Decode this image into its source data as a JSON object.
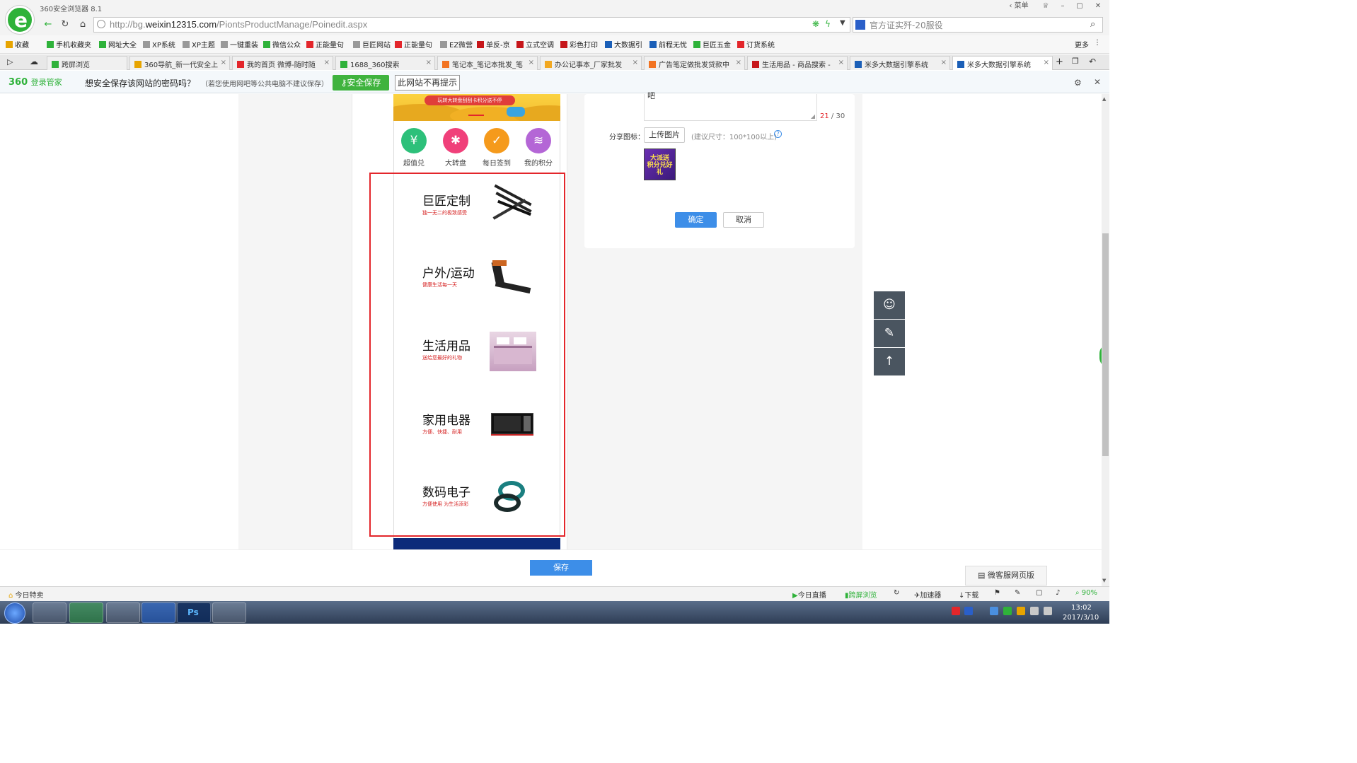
{
  "window": {
    "title": "360安全浏览器 8.1",
    "controls": [
      "菜单"
    ]
  },
  "address": {
    "url_prefix": "http://bg.",
    "url_domain": "weixin12315.com",
    "url_path": "/PiontsProductManage/Poinedit.aspx",
    "search_text": "官方证实歼-20服役"
  },
  "bookmarks": {
    "items": [
      {
        "label": "收藏",
        "color": "#e7a400"
      },
      {
        "label": "手机收藏夹",
        "color": "#2fb23a"
      },
      {
        "label": "网址大全",
        "color": "#2fb23a"
      },
      {
        "label": "XP系统",
        "color": "#999999"
      },
      {
        "label": "XP主题",
        "color": "#999999"
      },
      {
        "label": "一键重装",
        "color": "#999999"
      },
      {
        "label": "微信公众",
        "color": "#2fb23a"
      },
      {
        "label": "正能量句",
        "color": "#e3262b"
      },
      {
        "label": "巨匠网站",
        "color": "#999999"
      },
      {
        "label": "正能量句",
        "color": "#e3262b"
      },
      {
        "label": "EZ微营",
        "color": "#999999"
      },
      {
        "label": "单反-京",
        "color": "#c6161a"
      },
      {
        "label": "立式空调",
        "color": "#c6161a"
      },
      {
        "label": "彩色打印",
        "color": "#c6161a"
      },
      {
        "label": "大数据引",
        "color": "#1b5fb7"
      },
      {
        "label": "前程无忧",
        "color": "#1b5fb7"
      },
      {
        "label": "巨匠五金",
        "color": "#2fb23a"
      },
      {
        "label": "订货系统",
        "color": "#e3262b"
      }
    ],
    "more": "更多"
  },
  "tabs": [
    {
      "label": "跨屏浏览",
      "color": "#2fb23a",
      "active": false
    },
    {
      "label": "360导航_新一代安全上",
      "color": "#e7a400",
      "active": false
    },
    {
      "label": "我的首页 微博-随时随",
      "color": "#e3262b",
      "active": false
    },
    {
      "label": "1688_360搜索",
      "color": "#2fb23a",
      "active": false
    },
    {
      "label": "笔记本_笔记本批发_笔",
      "color": "#f27321",
      "active": false
    },
    {
      "label": "办公记事本_厂家批发",
      "color": "#f2a821",
      "active": false
    },
    {
      "label": "广告笔定做批发贷款中",
      "color": "#f27321",
      "active": false
    },
    {
      "label": "生活用品 - 商品搜索 -",
      "color": "#c6161a",
      "active": false
    },
    {
      "label": "米多大数据引擎系统",
      "color": "#1b5fb7",
      "active": false
    },
    {
      "label": "米多大数据引擎系统",
      "color": "#1b5fb7",
      "active": true
    }
  ],
  "password_bar": {
    "brand": "360",
    "brand_suffix": "登录管家",
    "question": "想安全保存该网站的密码吗？",
    "note": "（若您使用网吧等公共电脑不建议保存）",
    "save_label": "安全保存",
    "never_label": "此网站不再提示"
  },
  "phone": {
    "banner_text": "玩转大转盘刮刮卡积分送不停",
    "icons": [
      {
        "label": "超值兑",
        "color": "#2dc07a",
        "glyph": "¥"
      },
      {
        "label": "大转盘",
        "color": "#f0407a",
        "glyph": "✱"
      },
      {
        "label": "每日签到",
        "color": "#f59a1c",
        "glyph": "✓"
      },
      {
        "label": "我的积分",
        "color": "#b466d6",
        "glyph": "≋"
      }
    ],
    "categories": [
      {
        "title": "巨匠定制",
        "subtitle": "独一无二的极致感受",
        "img": "pens"
      },
      {
        "title": "户外/运动",
        "subtitle": "健康生活每一天",
        "img": "treadmill"
      },
      {
        "title": "生活用品",
        "subtitle": "送给您最好的礼物",
        "img": "bedding"
      },
      {
        "title": "家用电器",
        "subtitle": "方便、快捷、耐用",
        "img": "microwave"
      },
      {
        "title": "数码电子",
        "subtitle": "方便使用 为生活添彩",
        "img": "band"
      }
    ]
  },
  "form": {
    "textarea_value": "吧",
    "count_current": "21",
    "count_max": " / 30",
    "share_label": "分享图标：",
    "upload_label": "上传图片",
    "upload_hint": "(建议尺寸：100*100以上)",
    "share_img_text": "大派送 积分兑好礼",
    "ok_label": "确定",
    "cancel_label": "取消",
    "save_label": "保存"
  },
  "side_tools": [
    {
      "icon": "headset-icon",
      "glyph": "☊"
    },
    {
      "icon": "edit-icon",
      "glyph": "✎"
    },
    {
      "icon": "arrow-up-icon",
      "glyph": "↑"
    }
  ],
  "weikeb_label": "微客服网页版",
  "statusbar": {
    "left": "今日特卖",
    "items": [
      "今日直播",
      "跨屏浏览",
      "加速器",
      "下载"
    ],
    "zoom": "90%"
  },
  "taskbar": {
    "time": "13:02",
    "date": "2017/3/10"
  }
}
